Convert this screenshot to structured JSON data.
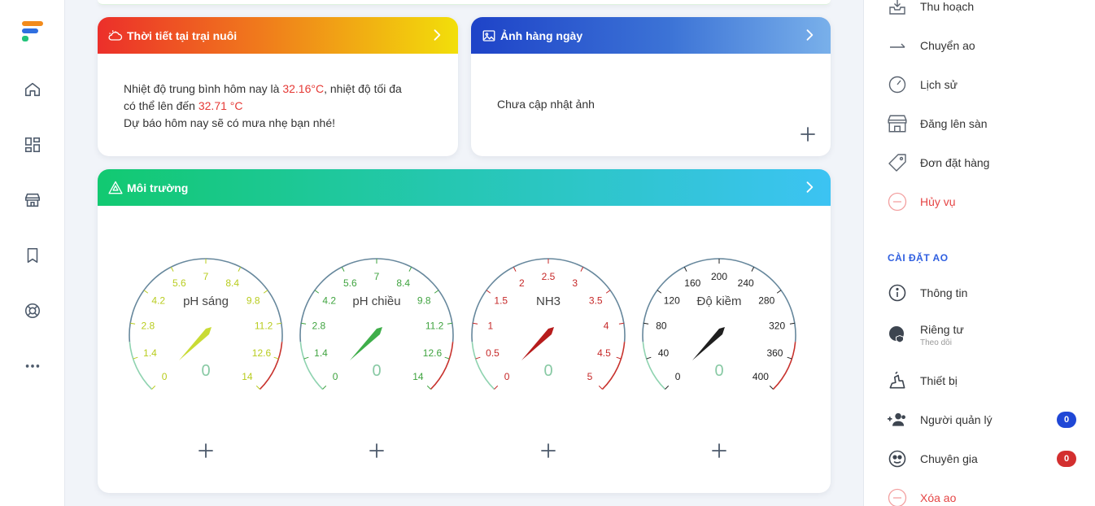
{
  "weather": {
    "title": "Thời tiết tại trại nuôi",
    "line1_a": "Nhiệt độ trung bình hôm nay là ",
    "avg_temp": "32.16°C",
    "line1_b": ", nhiệt độ tối đa",
    "line2_a": "có thể lên đến ",
    "max_temp": "32.71 °C",
    "line3": "Dự báo hôm nay sẽ có mưa nhẹ bạn nhé!"
  },
  "photo": {
    "title": "Ảnh hàng ngày",
    "empty_text": "Chưa cập nhật ảnh"
  },
  "environment": {
    "title": "Môi trường",
    "gauges": [
      {
        "label": "pH sáng",
        "value": "0",
        "ticks": [
          "0",
          "1.4",
          "2.8",
          "4.2",
          "5.6",
          "7",
          "8.4",
          "9.8",
          "11.2",
          "12.6",
          "14"
        ],
        "tick_color": "#b8cc1e",
        "needle_color": "#c9db35"
      },
      {
        "label": "pH chiều",
        "value": "0",
        "ticks": [
          "0",
          "1.4",
          "2.8",
          "4.2",
          "5.6",
          "7",
          "8.4",
          "9.8",
          "11.2",
          "12.6",
          "14"
        ],
        "tick_color": "#3fa33f",
        "needle_color": "#3fae4a"
      },
      {
        "label": "NH3",
        "value": "0",
        "ticks": [
          "0",
          "0.5",
          "1",
          "1.5",
          "2",
          "2.5",
          "3",
          "3.5",
          "4",
          "4.5",
          "5"
        ],
        "tick_color": "#c62828",
        "needle_color": "#b71c1c"
      },
      {
        "label": "Độ kiềm",
        "value": "0",
        "ticks": [
          "0",
          "40",
          "80",
          "120",
          "160",
          "200",
          "240",
          "280",
          "320",
          "360",
          "400"
        ],
        "tick_color": "#222222",
        "needle_color": "#1f1f1f"
      }
    ]
  },
  "right_menu": {
    "items_top": [
      {
        "label": "Thu hoạch",
        "icon": "harvest-icon"
      },
      {
        "label": "Chuyển ao",
        "icon": "transfer-icon"
      },
      {
        "label": "Lịch sử",
        "icon": "history-icon"
      },
      {
        "label": "Đăng lên sàn",
        "icon": "store-icon"
      },
      {
        "label": "Đơn đặt hàng",
        "icon": "tag-icon"
      },
      {
        "label": "Hủy vụ",
        "icon": "cancel-icon"
      }
    ],
    "section_title": "CÀI ĐẶT AO",
    "items_settings": [
      {
        "label": "Thông tin",
        "icon": "info-icon"
      },
      {
        "label": "Riêng tư",
        "sub": "Theo dõi",
        "icon": "privacy-icon"
      },
      {
        "label": "Thiết bị",
        "icon": "device-icon"
      },
      {
        "label": "Người quản lý",
        "icon": "managers-icon",
        "badge": "0"
      },
      {
        "label": "Chuyên gia",
        "icon": "expert-icon",
        "badge": "0"
      },
      {
        "label": "Xóa ao",
        "icon": "delete-icon"
      }
    ]
  },
  "colors": {
    "accent_blue": "#2f5fe0",
    "danger": "#e54545",
    "badge_blue": "#1f47d6",
    "badge_red": "#d32f2f"
  }
}
